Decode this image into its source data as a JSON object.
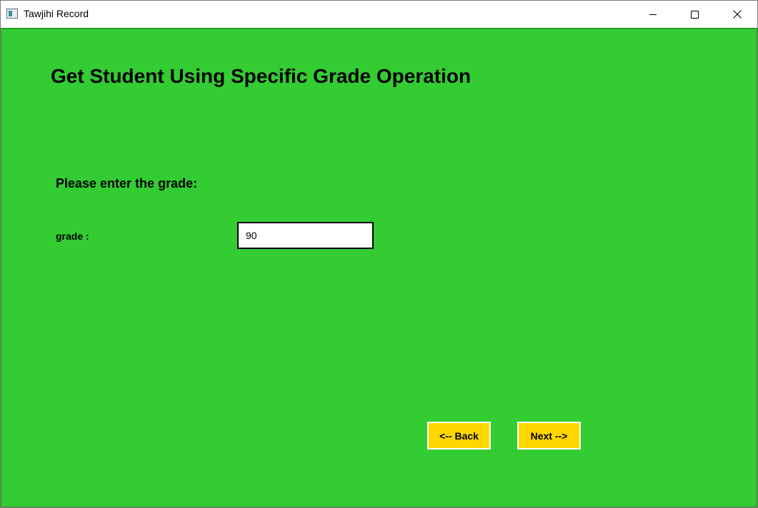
{
  "window": {
    "title": "Tawjihi Record"
  },
  "page": {
    "heading": "Get Student Using Specific Grade Operation",
    "prompt": "Please enter the grade:",
    "grade_label": "grade :",
    "grade_value": "90"
  },
  "buttons": {
    "back_label": "<-- Back",
    "next_label": "Next -->"
  },
  "colors": {
    "background": "#33cc33",
    "button": "#ffd700"
  },
  "icons": {
    "app": "app-window-icon",
    "minimize": "minimize-icon",
    "maximize": "maximize-icon",
    "close": "close-icon"
  }
}
